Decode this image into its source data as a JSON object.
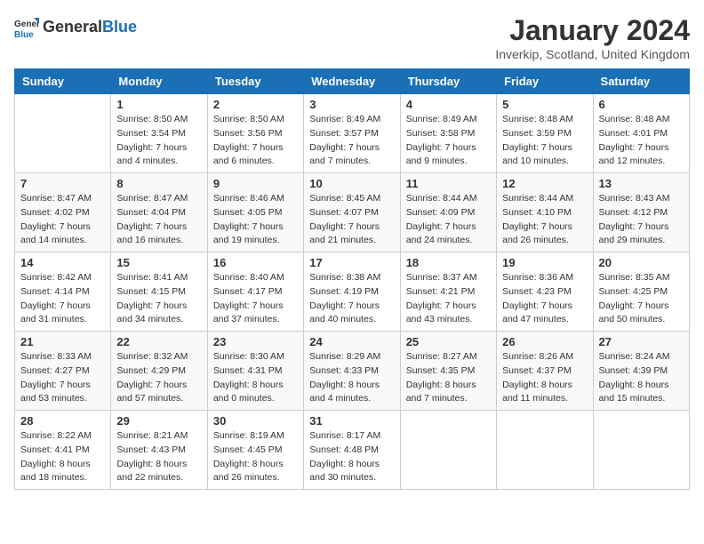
{
  "header": {
    "logo_general": "General",
    "logo_blue": "Blue",
    "title": "January 2024",
    "subtitle": "Inverkip, Scotland, United Kingdom"
  },
  "days_of_week": [
    "Sunday",
    "Monday",
    "Tuesday",
    "Wednesday",
    "Thursday",
    "Friday",
    "Saturday"
  ],
  "weeks": [
    [
      {
        "day": "",
        "info": ""
      },
      {
        "day": "1",
        "info": "Sunrise: 8:50 AM\nSunset: 3:54 PM\nDaylight: 7 hours\nand 4 minutes."
      },
      {
        "day": "2",
        "info": "Sunrise: 8:50 AM\nSunset: 3:56 PM\nDaylight: 7 hours\nand 6 minutes."
      },
      {
        "day": "3",
        "info": "Sunrise: 8:49 AM\nSunset: 3:57 PM\nDaylight: 7 hours\nand 7 minutes."
      },
      {
        "day": "4",
        "info": "Sunrise: 8:49 AM\nSunset: 3:58 PM\nDaylight: 7 hours\nand 9 minutes."
      },
      {
        "day": "5",
        "info": "Sunrise: 8:48 AM\nSunset: 3:59 PM\nDaylight: 7 hours\nand 10 minutes."
      },
      {
        "day": "6",
        "info": "Sunrise: 8:48 AM\nSunset: 4:01 PM\nDaylight: 7 hours\nand 12 minutes."
      }
    ],
    [
      {
        "day": "7",
        "info": "Sunrise: 8:47 AM\nSunset: 4:02 PM\nDaylight: 7 hours\nand 14 minutes."
      },
      {
        "day": "8",
        "info": "Sunrise: 8:47 AM\nSunset: 4:04 PM\nDaylight: 7 hours\nand 16 minutes."
      },
      {
        "day": "9",
        "info": "Sunrise: 8:46 AM\nSunset: 4:05 PM\nDaylight: 7 hours\nand 19 minutes."
      },
      {
        "day": "10",
        "info": "Sunrise: 8:45 AM\nSunset: 4:07 PM\nDaylight: 7 hours\nand 21 minutes."
      },
      {
        "day": "11",
        "info": "Sunrise: 8:44 AM\nSunset: 4:09 PM\nDaylight: 7 hours\nand 24 minutes."
      },
      {
        "day": "12",
        "info": "Sunrise: 8:44 AM\nSunset: 4:10 PM\nDaylight: 7 hours\nand 26 minutes."
      },
      {
        "day": "13",
        "info": "Sunrise: 8:43 AM\nSunset: 4:12 PM\nDaylight: 7 hours\nand 29 minutes."
      }
    ],
    [
      {
        "day": "14",
        "info": "Sunrise: 8:42 AM\nSunset: 4:14 PM\nDaylight: 7 hours\nand 31 minutes."
      },
      {
        "day": "15",
        "info": "Sunrise: 8:41 AM\nSunset: 4:15 PM\nDaylight: 7 hours\nand 34 minutes."
      },
      {
        "day": "16",
        "info": "Sunrise: 8:40 AM\nSunset: 4:17 PM\nDaylight: 7 hours\nand 37 minutes."
      },
      {
        "day": "17",
        "info": "Sunrise: 8:38 AM\nSunset: 4:19 PM\nDaylight: 7 hours\nand 40 minutes."
      },
      {
        "day": "18",
        "info": "Sunrise: 8:37 AM\nSunset: 4:21 PM\nDaylight: 7 hours\nand 43 minutes."
      },
      {
        "day": "19",
        "info": "Sunrise: 8:36 AM\nSunset: 4:23 PM\nDaylight: 7 hours\nand 47 minutes."
      },
      {
        "day": "20",
        "info": "Sunrise: 8:35 AM\nSunset: 4:25 PM\nDaylight: 7 hours\nand 50 minutes."
      }
    ],
    [
      {
        "day": "21",
        "info": "Sunrise: 8:33 AM\nSunset: 4:27 PM\nDaylight: 7 hours\nand 53 minutes."
      },
      {
        "day": "22",
        "info": "Sunrise: 8:32 AM\nSunset: 4:29 PM\nDaylight: 7 hours\nand 57 minutes."
      },
      {
        "day": "23",
        "info": "Sunrise: 8:30 AM\nSunset: 4:31 PM\nDaylight: 8 hours\nand 0 minutes."
      },
      {
        "day": "24",
        "info": "Sunrise: 8:29 AM\nSunset: 4:33 PM\nDaylight: 8 hours\nand 4 minutes."
      },
      {
        "day": "25",
        "info": "Sunrise: 8:27 AM\nSunset: 4:35 PM\nDaylight: 8 hours\nand 7 minutes."
      },
      {
        "day": "26",
        "info": "Sunrise: 8:26 AM\nSunset: 4:37 PM\nDaylight: 8 hours\nand 11 minutes."
      },
      {
        "day": "27",
        "info": "Sunrise: 8:24 AM\nSunset: 4:39 PM\nDaylight: 8 hours\nand 15 minutes."
      }
    ],
    [
      {
        "day": "28",
        "info": "Sunrise: 8:22 AM\nSunset: 4:41 PM\nDaylight: 8 hours\nand 18 minutes."
      },
      {
        "day": "29",
        "info": "Sunrise: 8:21 AM\nSunset: 4:43 PM\nDaylight: 8 hours\nand 22 minutes."
      },
      {
        "day": "30",
        "info": "Sunrise: 8:19 AM\nSunset: 4:45 PM\nDaylight: 8 hours\nand 26 minutes."
      },
      {
        "day": "31",
        "info": "Sunrise: 8:17 AM\nSunset: 4:48 PM\nDaylight: 8 hours\nand 30 minutes."
      },
      {
        "day": "",
        "info": ""
      },
      {
        "day": "",
        "info": ""
      },
      {
        "day": "",
        "info": ""
      }
    ]
  ]
}
